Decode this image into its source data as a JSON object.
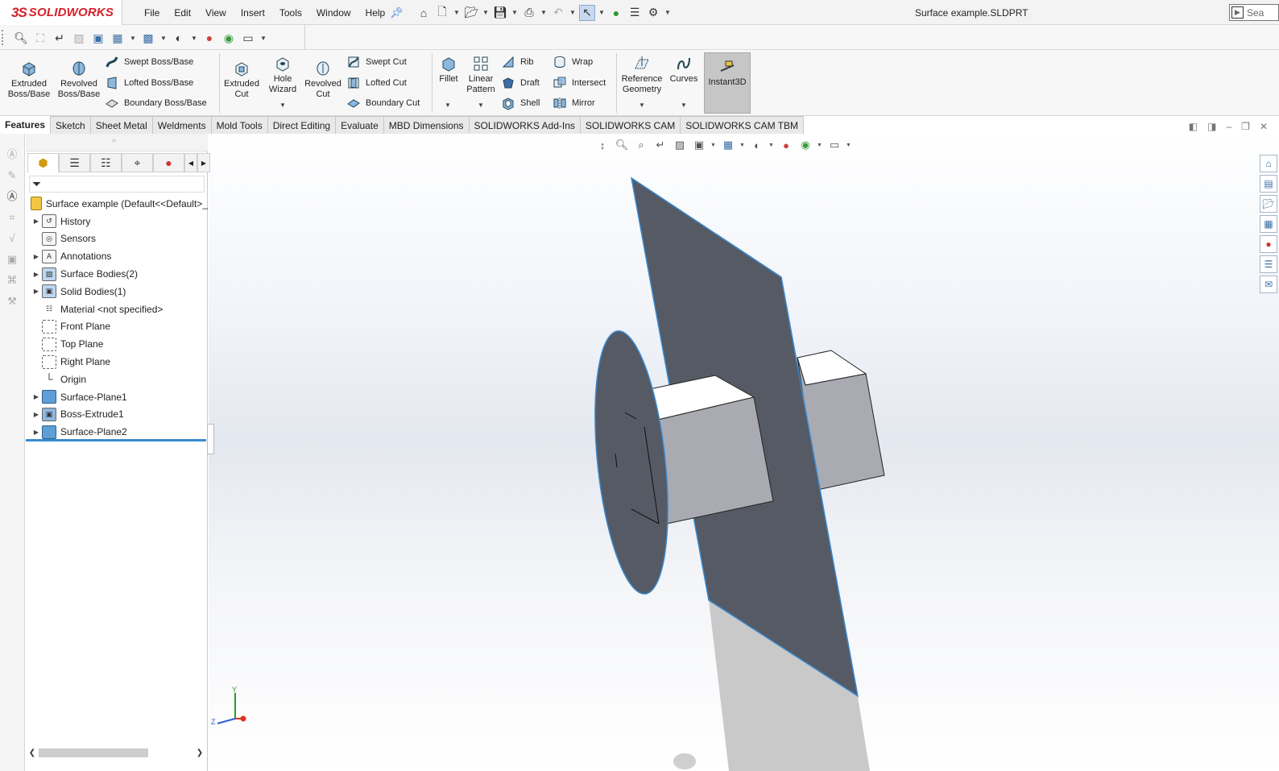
{
  "app": {
    "brand_ds": "3S",
    "brand_name": "SOLIDWORKS",
    "document_title": "Surface example.SLDPRT",
    "search_placeholder": "Sea"
  },
  "menu": {
    "items": [
      "File",
      "Edit",
      "View",
      "Insert",
      "Tools",
      "Window",
      "Help"
    ]
  },
  "ribbon": {
    "extruded_boss": "Extruded\nBoss/Base",
    "revolved_boss": "Revolved\nBoss/Base",
    "swept_boss": "Swept Boss/Base",
    "lofted_boss": "Lofted Boss/Base",
    "boundary_boss": "Boundary Boss/Base",
    "extruded_cut": "Extruded\nCut",
    "hole_wizard": "Hole\nWizard",
    "revolved_cut": "Revolved\nCut",
    "swept_cut": "Swept Cut",
    "lofted_cut": "Lofted Cut",
    "boundary_cut": "Boundary Cut",
    "fillet": "Fillet",
    "linear_pattern": "Linear\nPattern",
    "rib": "Rib",
    "draft": "Draft",
    "shell": "Shell",
    "wrap": "Wrap",
    "intersect": "Intersect",
    "mirror": "Mirror",
    "reference_geometry": "Reference\nGeometry",
    "curves": "Curves",
    "instant3d": "Instant3D"
  },
  "tabs": [
    {
      "label": "Features",
      "active": true
    },
    {
      "label": "Sketch",
      "active": false
    },
    {
      "label": "Sheet Metal",
      "active": false
    },
    {
      "label": "Weldments",
      "active": false
    },
    {
      "label": "Mold Tools",
      "active": false
    },
    {
      "label": "Direct Editing",
      "active": false
    },
    {
      "label": "Evaluate",
      "active": false
    },
    {
      "label": "MBD Dimensions",
      "active": false
    },
    {
      "label": "SOLIDWORKS Add-Ins",
      "active": false
    },
    {
      "label": "SOLIDWORKS CAM",
      "active": false
    },
    {
      "label": "SOLIDWORKS CAM TBM",
      "active": false
    }
  ],
  "feature_tree": {
    "root": "Surface example  (Default<<Default>_",
    "items": [
      {
        "label": "History",
        "expandable": true,
        "icon": "history-icon"
      },
      {
        "label": "Sensors",
        "expandable": false,
        "icon": "sensors-icon"
      },
      {
        "label": "Annotations",
        "expandable": true,
        "icon": "annotations-icon"
      },
      {
        "label": "Surface Bodies(2)",
        "expandable": true,
        "icon": "surface-bodies-icon"
      },
      {
        "label": "Solid Bodies(1)",
        "expandable": true,
        "icon": "solid-bodies-icon"
      },
      {
        "label": "Material <not specified>",
        "expandable": false,
        "icon": "material-icon"
      },
      {
        "label": "Front Plane",
        "expandable": false,
        "icon": "plane-icon"
      },
      {
        "label": "Top Plane",
        "expandable": false,
        "icon": "plane-icon"
      },
      {
        "label": "Right Plane",
        "expandable": false,
        "icon": "plane-icon"
      },
      {
        "label": "Origin",
        "expandable": false,
        "icon": "origin-icon"
      },
      {
        "label": "Surface-Plane1",
        "expandable": true,
        "icon": "surface-plane-icon"
      },
      {
        "label": "Boss-Extrude1",
        "expandable": true,
        "icon": "boss-extrude-icon"
      },
      {
        "label": "Surface-Plane2",
        "expandable": true,
        "icon": "surface-plane-icon"
      }
    ]
  },
  "triad": {
    "x": "",
    "y": "Y",
    "z": "Z"
  },
  "colors": {
    "brand_red": "#d6202a",
    "surface_plane": "#555a64",
    "edge_blue": "#3a8ad0",
    "box_side": "#a9aab2",
    "box_top": "#ffffff"
  }
}
